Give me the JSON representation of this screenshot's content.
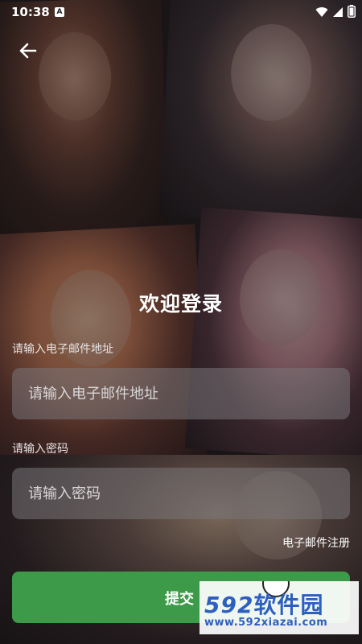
{
  "status_bar": {
    "time": "10:38",
    "notification_badge": "A",
    "icons": [
      "wifi-icon",
      "signal-icon",
      "battery-icon"
    ]
  },
  "back": {
    "icon": "arrow-left-icon"
  },
  "form": {
    "title": "欢迎登录",
    "email_label": "请输入电子邮件地址",
    "email_placeholder": "请输入电子邮件地址",
    "email_value": "",
    "password_label": "请输入密码",
    "password_placeholder": "请输入密码",
    "password_value": "",
    "register_link": "电子邮件注册",
    "submit_label": "提交"
  },
  "watermark": {
    "logo_number": "592",
    "logo_text": "软件园",
    "url": "www.592xiazai.com"
  },
  "colors": {
    "submit_button": "#3c9a48",
    "watermark_blue": "#2d5fbf"
  }
}
